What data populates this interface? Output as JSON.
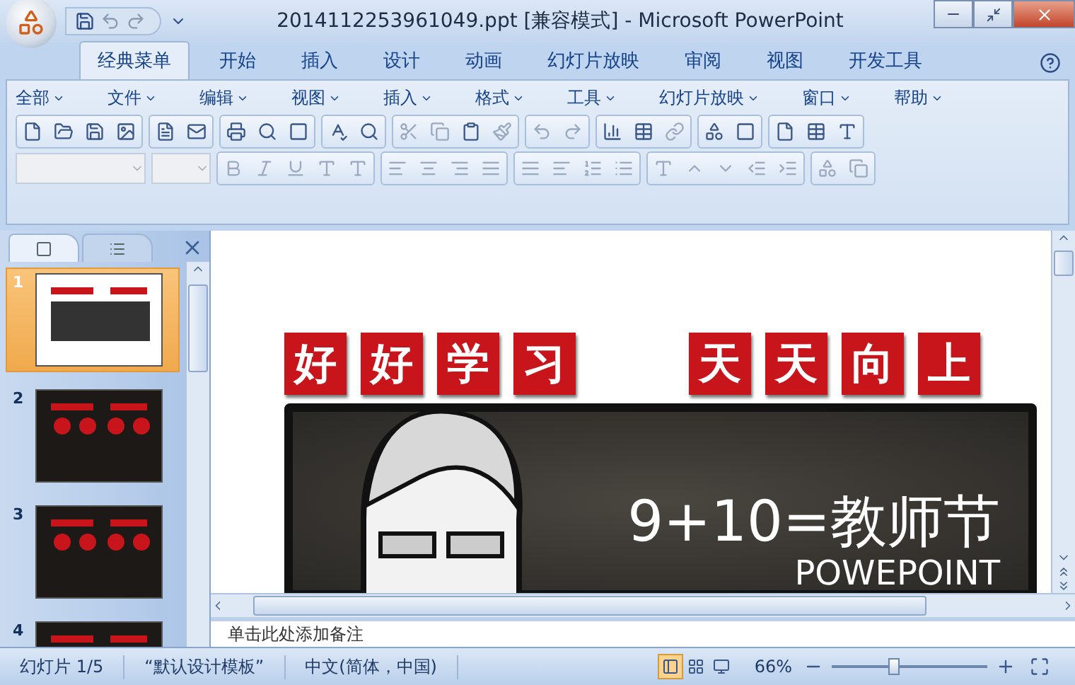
{
  "window": {
    "title": "2014112253961049.ppt [兼容模式] - Microsoft PowerPoint"
  },
  "ribbon_tabs": [
    {
      "label": "经典菜单",
      "selected": true
    },
    {
      "label": "开始",
      "selected": false
    },
    {
      "label": "插入",
      "selected": false
    },
    {
      "label": "设计",
      "selected": false
    },
    {
      "label": "动画",
      "selected": false
    },
    {
      "label": "幻灯片放映",
      "selected": false
    },
    {
      "label": "审阅",
      "selected": false
    },
    {
      "label": "视图",
      "selected": false
    },
    {
      "label": "开发工具",
      "selected": false
    }
  ],
  "menus": [
    "全部",
    "文件",
    "编辑",
    "视图",
    "插入",
    "格式",
    "工具",
    "幻灯片放映",
    "窗口",
    "帮助"
  ],
  "slide_panel": {
    "tabs": [
      {
        "kind": "slides",
        "selected": true
      },
      {
        "kind": "outline",
        "selected": false
      }
    ],
    "thumbnails": [
      {
        "number": "1",
        "kind": "title",
        "selected": true
      },
      {
        "number": "2",
        "kind": "dark",
        "selected": false
      },
      {
        "number": "3",
        "kind": "dark",
        "selected": false
      },
      {
        "number": "4",
        "kind": "dark",
        "selected": false
      }
    ]
  },
  "slide": {
    "banner_left": [
      "好",
      "好",
      "学",
      "习"
    ],
    "banner_right": [
      "天",
      "天",
      "向",
      "上"
    ],
    "title": "9+10=教师节",
    "subtitle": "POWEPOINT"
  },
  "notes": {
    "placeholder": "单击此处添加备注"
  },
  "status_bar": {
    "slide": "幻灯片 1/5",
    "theme": "“默认设计模板”",
    "language": "中文(简体，中国)",
    "views": [
      {
        "kind": "normal",
        "selected": true
      },
      {
        "kind": "sorter",
        "selected": false
      },
      {
        "kind": "show",
        "selected": false
      }
    ],
    "zoom": "66%",
    "zoom_slider": {
      "level": 0.4
    }
  }
}
